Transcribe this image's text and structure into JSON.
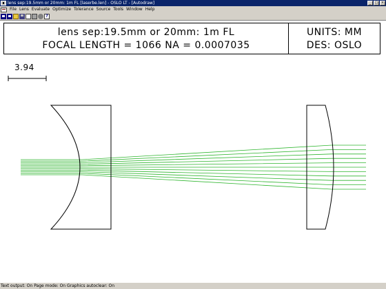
{
  "window": {
    "title": "lens sep:19.5mm or 20mm: 1m FL [laserbe.len] - OSLO LT - [Autodraw]",
    "controls": [
      "_",
      "□",
      "×"
    ]
  },
  "menu": {
    "items": [
      "File",
      "Lens",
      "Evaluate",
      "Optimize",
      "Tolerance",
      "Source",
      "Tools",
      "Window",
      "Help"
    ]
  },
  "toolbar": {
    "buttons": [
      "window-icon",
      "window-icon",
      "folder-icon",
      "save-icon",
      "document-icon",
      "print-icon",
      "settings-icon",
      "help-icon"
    ],
    "help_glyph": "?"
  },
  "drawing": {
    "title": "lens sep:19.5mm or 20mm: 1m FL",
    "focal_line": "FOCAL LENGTH = 1066  NA = 0.0007035",
    "units": "UNITS: MM",
    "designer": "DES: OSLO",
    "scale_value": "3.94",
    "ray_color": "#2db52d"
  },
  "status": {
    "text": "Text output: On  Page mode: On  Graphics autoclear: On"
  }
}
